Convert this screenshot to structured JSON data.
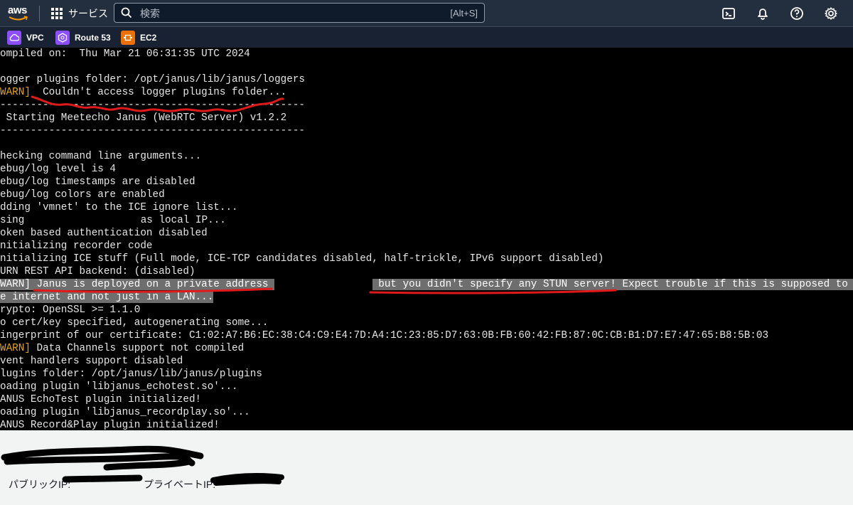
{
  "header": {
    "logo_text": "aws",
    "services_label": "サービス",
    "search": {
      "placeholder": "検索",
      "shortcut": "[Alt+S]"
    },
    "icons": [
      "cloudshell-icon",
      "notifications-icon",
      "help-icon",
      "settings-icon"
    ]
  },
  "favorites": [
    {
      "label": "VPC",
      "color": "#8c4fff"
    },
    {
      "label": "Route 53",
      "color": "#8c4fff"
    },
    {
      "label": "EC2",
      "color": "#ed7100"
    }
  ],
  "terminal": {
    "lines": [
      {
        "segments": [
          {
            "text": "ompiled on:  Thu Mar 21 06:31:35 UTC 2024"
          }
        ]
      },
      {
        "segments": [
          {
            "text": ""
          }
        ]
      },
      {
        "segments": [
          {
            "text": "ogger plugins folder: /opt/janus/lib/janus/loggers"
          }
        ]
      },
      {
        "segments": [
          {
            "text": "WARN]",
            "cls": "warn"
          },
          {
            "text": "  Couldn't access logger plugins folder..."
          }
        ]
      },
      {
        "segments": [
          {
            "text": "--------------------------------------------------"
          }
        ]
      },
      {
        "segments": [
          {
            "text": " Starting Meetecho Janus (WebRTC Server) v1.2.2"
          }
        ]
      },
      {
        "segments": [
          {
            "text": "--------------------------------------------------"
          }
        ]
      },
      {
        "segments": [
          {
            "text": ""
          }
        ]
      },
      {
        "segments": [
          {
            "text": "hecking command line arguments..."
          }
        ]
      },
      {
        "segments": [
          {
            "text": "ebug/log level is 4"
          }
        ]
      },
      {
        "segments": [
          {
            "text": "ebug/log timestamps are disabled"
          }
        ]
      },
      {
        "segments": [
          {
            "text": "ebug/log colors are enabled"
          }
        ]
      },
      {
        "segments": [
          {
            "text": "dding 'vmnet' to the ICE ignore list..."
          }
        ]
      },
      {
        "segments": [
          {
            "text": "sing"
          },
          {
            "redact": 19
          },
          {
            "text": "as local IP..."
          }
        ]
      },
      {
        "segments": [
          {
            "text": "oken based authentication disabled"
          }
        ]
      },
      {
        "segments": [
          {
            "text": "nitializing recorder code"
          }
        ]
      },
      {
        "segments": [
          {
            "text": "nitializing ICE stuff (Full mode, ICE-TCP candidates disabled, half-trickle, IPv6 support disabled)"
          }
        ]
      },
      {
        "segments": [
          {
            "text": "URN REST API backend: (disabled)"
          }
        ]
      },
      {
        "segments": [
          {
            "text": "WARN]",
            "cls": "warn hl"
          },
          {
            "text": " Janus is deployed on a private address ",
            "cls": "hl"
          },
          {
            "redact": 16
          },
          {
            "text": " but you didn't specify any STUN server! Expect trouble if this is supposed to w",
            "cls": "hl"
          }
        ]
      },
      {
        "segments": [
          {
            "text": "e internet and not just in a LAN...",
            "cls": "hl"
          }
        ]
      },
      {
        "segments": [
          {
            "text": "rypto: OpenSSL >= 1.1.0"
          }
        ]
      },
      {
        "segments": [
          {
            "text": "o cert/key specified, autogenerating some..."
          }
        ]
      },
      {
        "segments": [
          {
            "text": "ingerprint of our certificate: C1:02:A7:B6:EC:38:C4:C9:E4:7D:A4:1C:23:85:D7:63:0B:FB:60:42:FB:87:0C:CB:B1:D7:E7:47:65:B8:5B:03"
          }
        ]
      },
      {
        "segments": [
          {
            "text": "WARN]",
            "cls": "warn"
          },
          {
            "text": " Data Channels support not compiled"
          }
        ]
      },
      {
        "segments": [
          {
            "text": "vent handlers support disabled"
          }
        ]
      },
      {
        "segments": [
          {
            "text": "lugins folder: /opt/janus/lib/janus/plugins"
          }
        ]
      },
      {
        "segments": [
          {
            "text": "oading plugin 'libjanus_echotest.so'..."
          }
        ]
      },
      {
        "segments": [
          {
            "text": "ANUS EchoTest plugin initialized!"
          }
        ]
      },
      {
        "segments": [
          {
            "text": "oading plugin 'libjanus_recordplay.so'..."
          }
        ]
      },
      {
        "segments": [
          {
            "text": "ANUS Record&Play plugin initialized!"
          }
        ]
      }
    ]
  },
  "instance": {
    "public_ip_label": "パブリックIP:",
    "private_ip_label": "プライベートIP:"
  }
}
